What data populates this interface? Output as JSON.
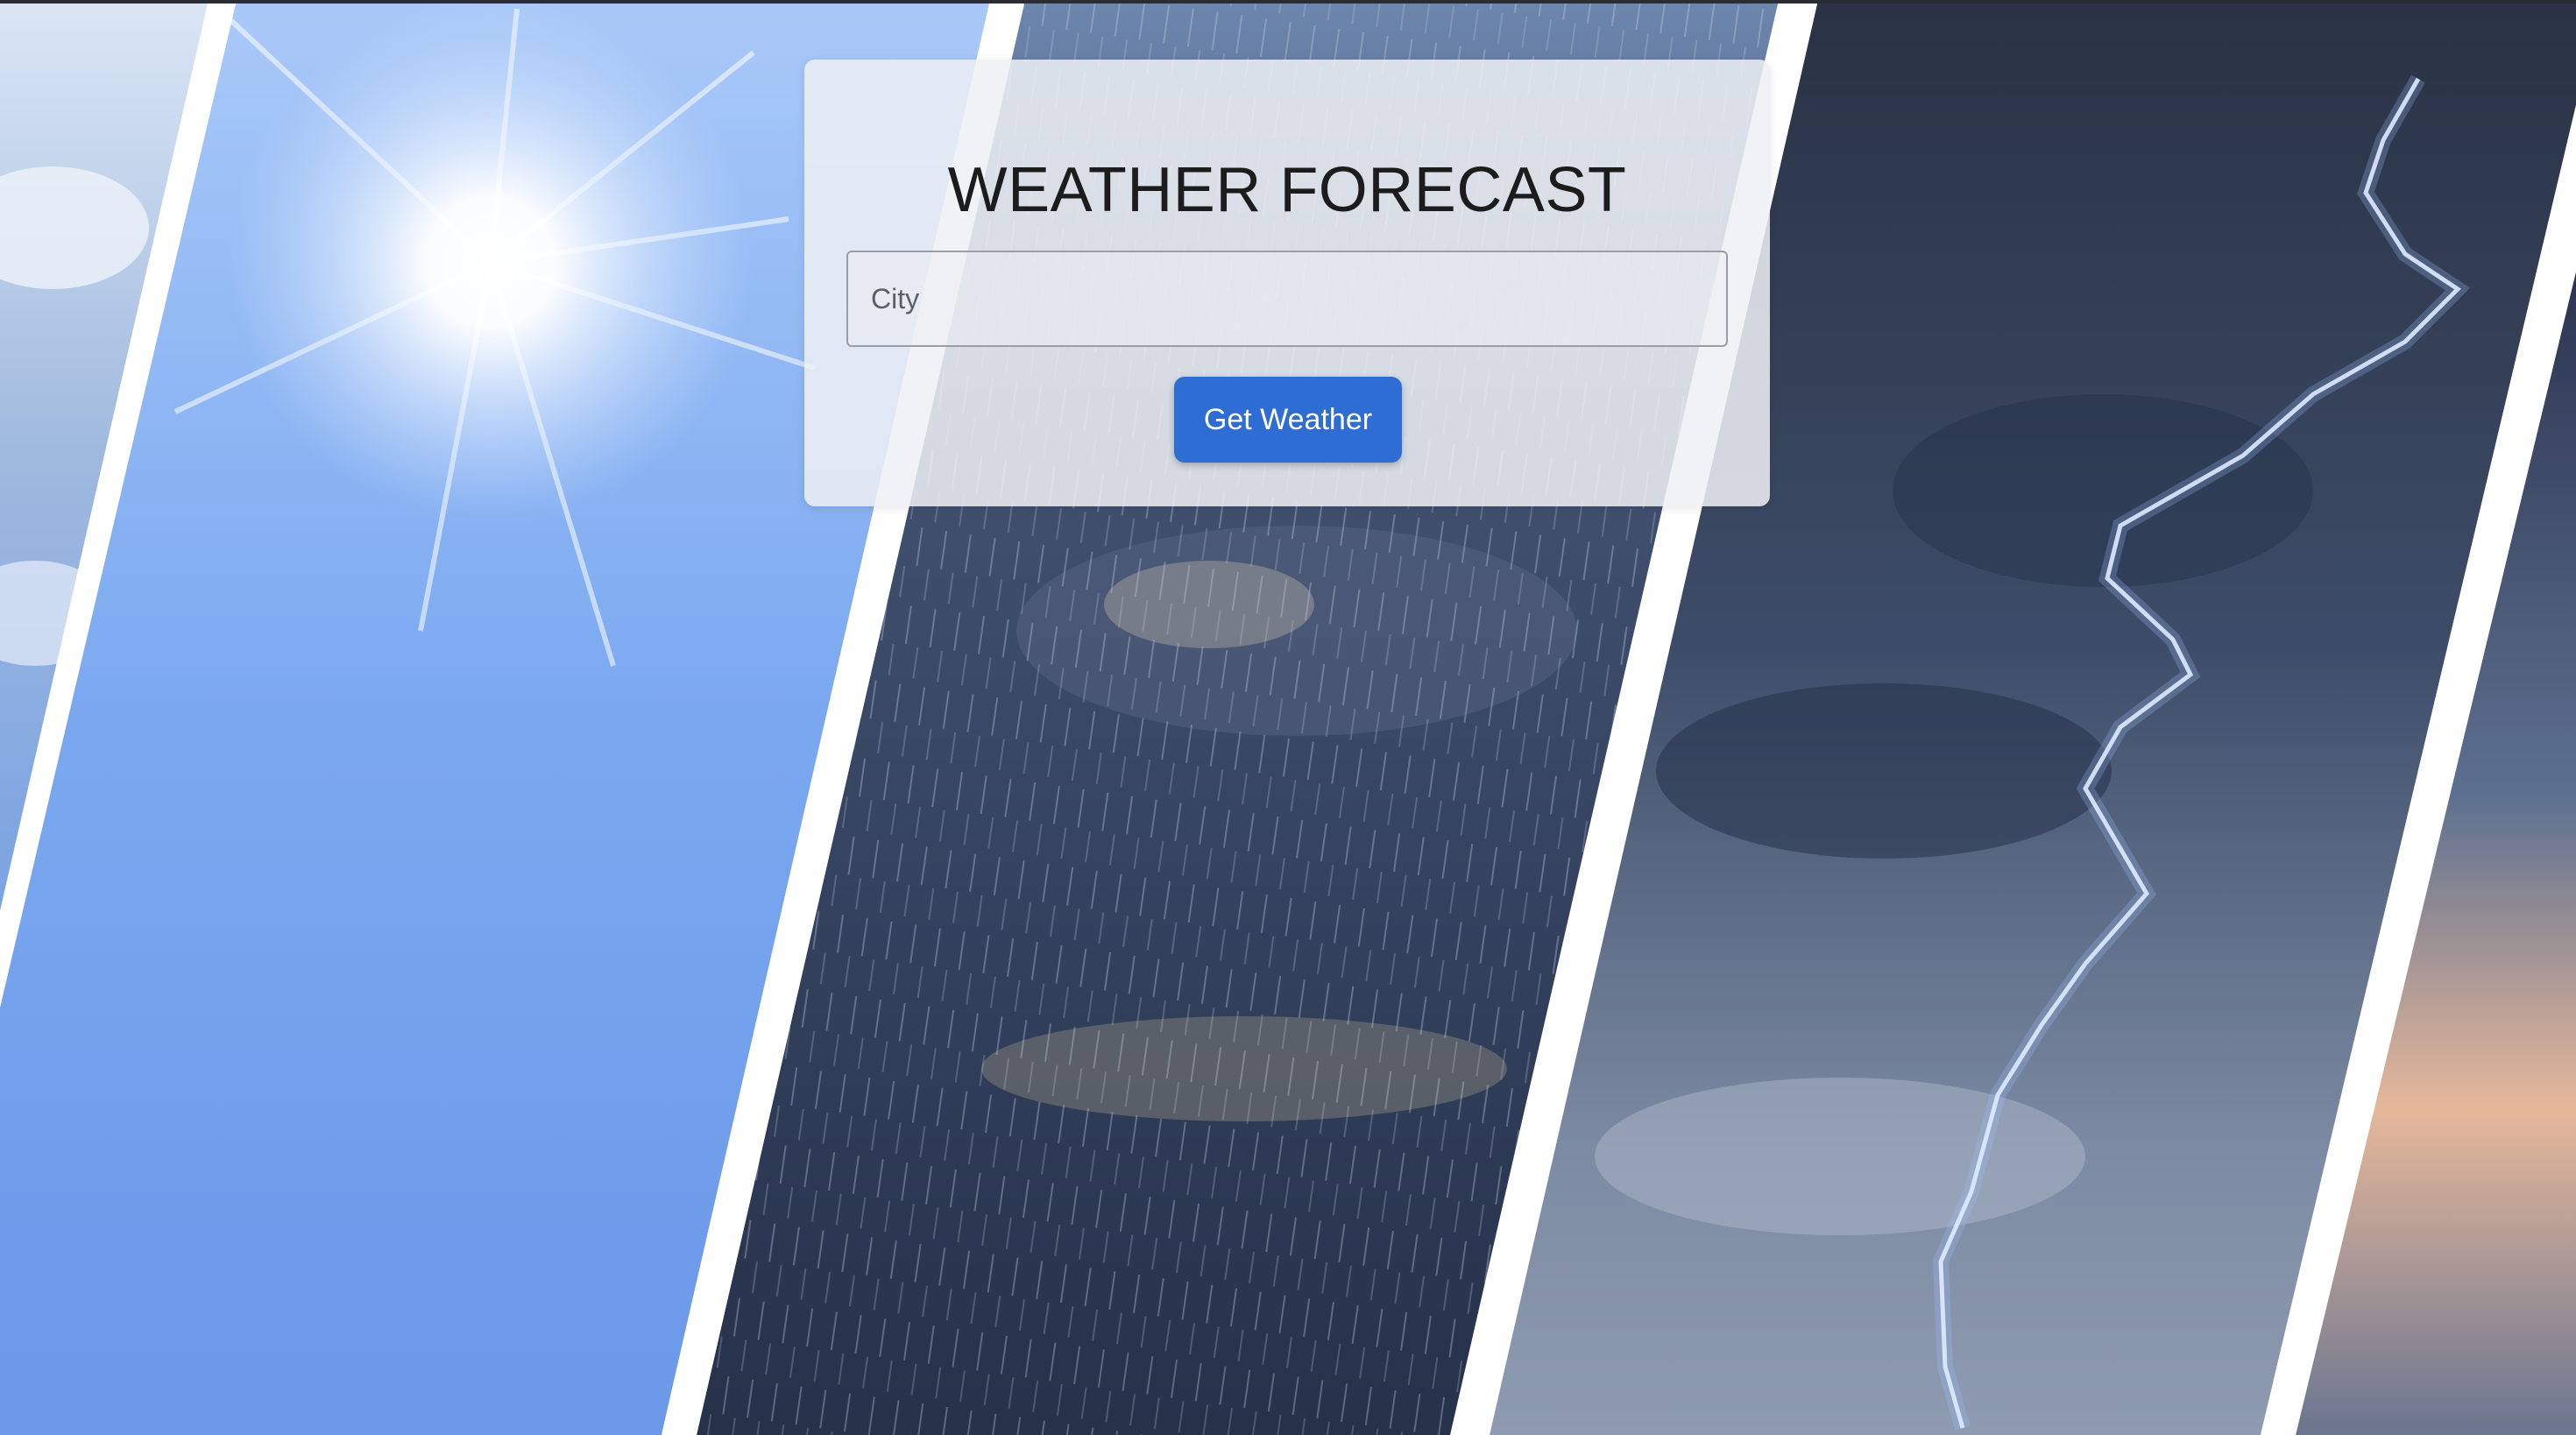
{
  "header": {
    "title": "WEATHER FORECAST"
  },
  "search": {
    "placeholder": "City",
    "value": ""
  },
  "actions": {
    "get_weather_label": "Get Weather"
  },
  "background": {
    "panels": [
      "sunny-panel",
      "rain-panel",
      "storm-panel",
      "sunset-panel"
    ],
    "colors": {
      "sky": "#7aa7f0",
      "rain": "#2c3a58",
      "storm": "#3d4d6a",
      "button": "#2e6dd3"
    }
  }
}
